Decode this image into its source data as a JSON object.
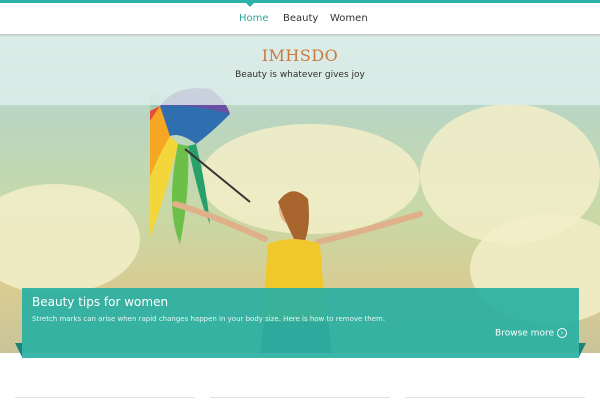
{
  "nav": {
    "items": [
      {
        "label": "Home",
        "active": true
      },
      {
        "label": "Beauty",
        "active": false
      },
      {
        "label": "Women",
        "active": false
      }
    ]
  },
  "header": {
    "site_title": "IMHSDO",
    "tagline": "Beauty is whatever gives joy"
  },
  "feature": {
    "title": "Beauty tips for women",
    "text": "Stretch marks can arise when rapid changes happen in your body size. Here is how to remove them.",
    "browse_label": "Browse more",
    "browse_icon": "arrow-right-circle-icon"
  },
  "colors": {
    "accent": "#2ab3a6",
    "title_orange": "#c97a3d"
  }
}
